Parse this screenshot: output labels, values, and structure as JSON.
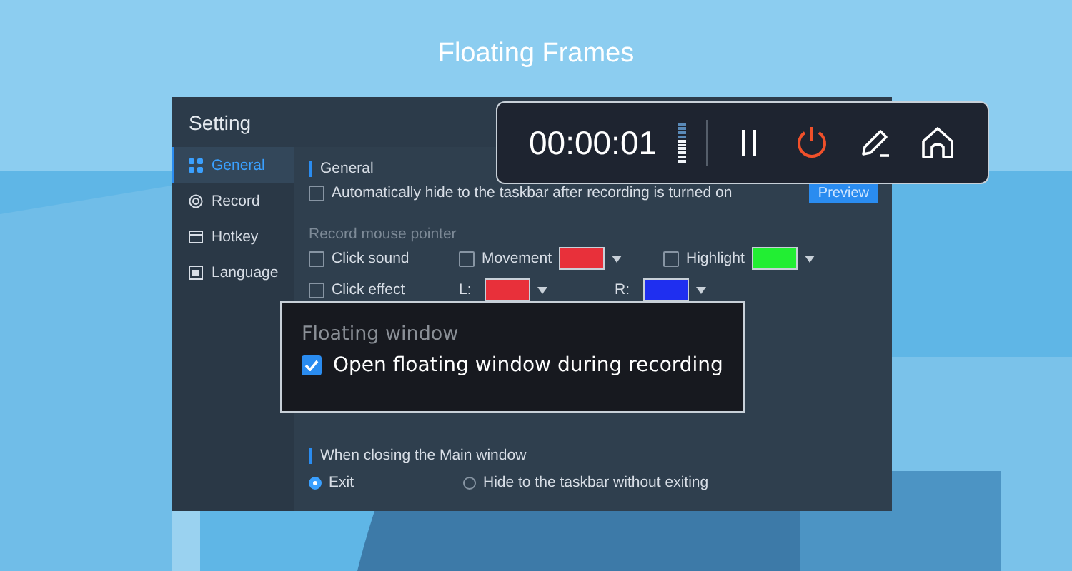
{
  "title": "Floating Frames",
  "window": {
    "title": "Setting"
  },
  "sidebar": {
    "items": [
      {
        "label": "General",
        "kind": "grid",
        "selected": true
      },
      {
        "label": "Record",
        "kind": "record",
        "selected": false
      },
      {
        "label": "Hotkey",
        "kind": "keyboard",
        "selected": false
      },
      {
        "label": "Language",
        "kind": "language",
        "selected": false
      }
    ]
  },
  "general": {
    "heading": "General",
    "auto_hide": {
      "label": "Automatically hide to the taskbar after recording is turned on",
      "checked": false
    },
    "preview_button": "Preview"
  },
  "mouse_pointer": {
    "heading": "Record mouse pointer",
    "options": [
      {
        "label": "Click sound",
        "checked": false
      },
      {
        "label": "Movement",
        "checked": false,
        "color": "#e8303a"
      },
      {
        "label": "Highlight",
        "checked": false,
        "color": "#22ee33"
      }
    ],
    "click_effect": {
      "label": "Click effect",
      "checked": false,
      "colors": [
        {
          "label": "L:",
          "color": "#e8303a"
        },
        {
          "label": "R:",
          "color": "#1f2ff0"
        }
      ]
    }
  },
  "closing": {
    "heading": "When closing the Main window",
    "options": [
      {
        "label": "Exit",
        "selected": true
      },
      {
        "label": "Hide to the taskbar without exiting",
        "selected": false
      }
    ]
  },
  "toolbar": {
    "time": "00:00:01",
    "level": 0.6,
    "buttons": [
      {
        "kind": "pause"
      },
      {
        "kind": "power"
      },
      {
        "kind": "pen"
      },
      {
        "kind": "home"
      }
    ]
  },
  "floating_window": {
    "heading": "Floating window",
    "option": {
      "label": "Open floating window during recording",
      "checked": true
    }
  }
}
